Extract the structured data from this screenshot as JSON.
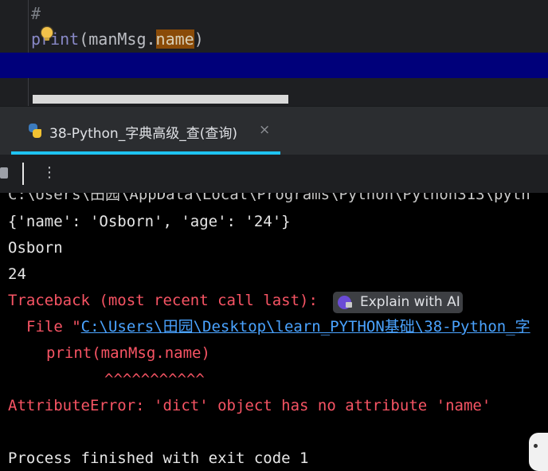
{
  "editor": {
    "line1": "#",
    "line2": {
      "builtin": "print",
      "before": "(manMsg.",
      "highlight": "name",
      "after": ")"
    }
  },
  "run_tab": {
    "label": "38-Python_字典高级_查(查询)",
    "close": "×"
  },
  "toolbar": {
    "more": "⋮"
  },
  "console": {
    "cut_line": "C:\\Users\\田园\\AppData\\Local\\Programs\\Python\\Python313\\pyth",
    "dict_line": "{'name': 'Osborn', 'age': '24'}",
    "name_line": "Osborn",
    "age_line": "24",
    "traceback": "Traceback (most recent call last):",
    "explain_ai": "Explain with AI",
    "file_prefix": "File \"",
    "file_path": "C:\\Users\\田园\\Desktop\\learn_PYTHON基础\\38-Python_字",
    "print_line": "print(manMsg.name)",
    "carets": "^^^^^^^^^^^",
    "attr_error": "AttributeError: 'dict' object has no attribute 'name'",
    "process": "Process finished with exit code 1"
  },
  "colors": {
    "accent": "#1fc3f2",
    "error": "#f75464",
    "link": "#4aa3ff",
    "current_line": "#00007a"
  }
}
